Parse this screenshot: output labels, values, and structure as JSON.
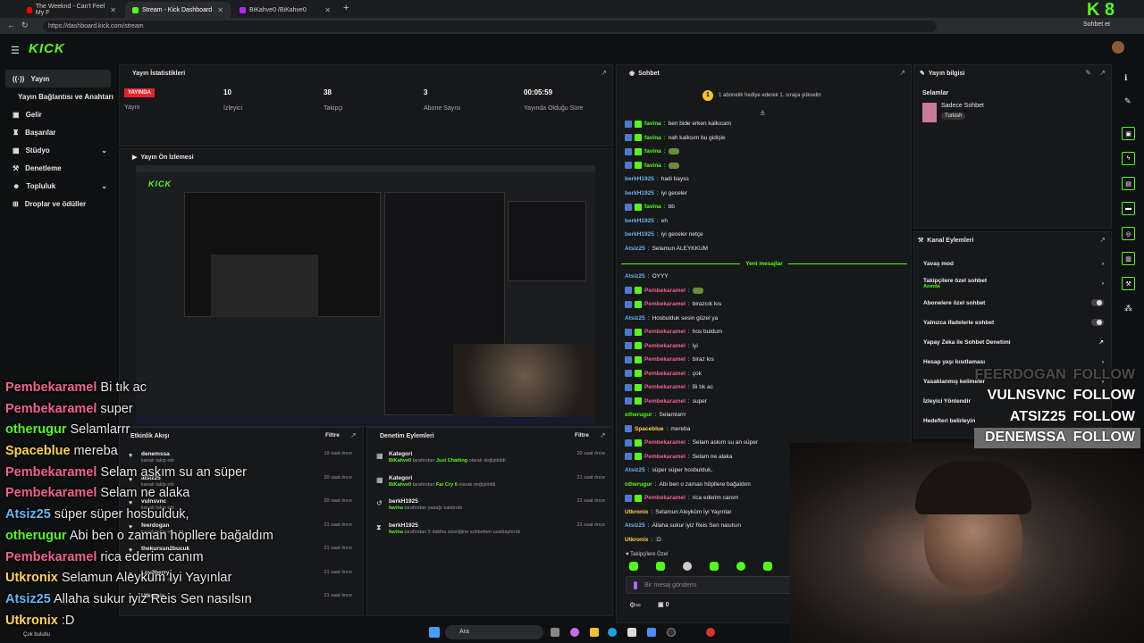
{
  "browser": {
    "tabs": [
      {
        "label": "The Weeknd - Can't Feel My F"
      },
      {
        "label": "Stream - Kick Dashboard"
      },
      {
        "label": "BiKahve0 /BiKahve0"
      }
    ],
    "url": "https://dashboard.kick.com/stream",
    "right_button": "Sohbet et"
  },
  "brand": {
    "logo": "KICK",
    "accent": "#53fc18",
    "corner_logo": "K 8"
  },
  "sidebar": {
    "items": [
      {
        "label": "Yayın",
        "icon": "broadcast-icon"
      },
      {
        "label": "Yayın Bağlantısı ve Anahtarı",
        "icon": ""
      },
      {
        "label": "Gelir",
        "icon": "money-icon"
      },
      {
        "label": "Başarılar",
        "icon": "trophy-icon"
      },
      {
        "label": "Stüdyo",
        "icon": "grid-icon"
      },
      {
        "label": "Denetleme",
        "icon": "wrench-icon"
      },
      {
        "label": "Topluluk",
        "icon": "people-icon"
      },
      {
        "label": "Droplar ve ödüller",
        "icon": "gift-icon"
      }
    ]
  },
  "stats": {
    "title": "Yayın İstatistikleri",
    "live_badge": "YAYINDA",
    "live_label": "Yayın",
    "items": [
      {
        "value": "10",
        "label": "İzleyici"
      },
      {
        "value": "38",
        "label": "Takipçi"
      },
      {
        "value": "3",
        "label": "Abone Sayısı"
      },
      {
        "value": "00:05:59",
        "label": "Yayında Olduğu Süre"
      }
    ]
  },
  "preview": {
    "title": "Yayın Ön İzlemesi"
  },
  "overlay_chat": [
    {
      "name": "Pembekaramel",
      "color": "#f06292",
      "msg": "Bi tık ac"
    },
    {
      "name": "Pembekaramel",
      "color": "#f06292",
      "msg": "super"
    },
    {
      "name": "otherugur",
      "color": "#53fc18",
      "msg": "Selamlarrr"
    },
    {
      "name": "Spaceblue",
      "color": "#ffd54f",
      "msg": "mereba"
    },
    {
      "name": "Pembekaramel",
      "color": "#f06292",
      "msg": "Selam askım su an süper"
    },
    {
      "name": "Pembekaramel",
      "color": "#f06292",
      "msg": "Selam ne alaka"
    },
    {
      "name": "Atsiz25",
      "color": "#64b5f6",
      "msg": "süper süper hosbulduk,"
    },
    {
      "name": "otherugur",
      "color": "#53fc18",
      "msg": "Abi ben o zaman höpllere bağaldım"
    },
    {
      "name": "Pembekaramel",
      "color": "#f06292",
      "msg": "rica ederim canım"
    },
    {
      "name": "Utkronix",
      "color": "#ffd54f",
      "msg": "Selamun Aleyküm İyi Yayınlar"
    },
    {
      "name": "Atsiz25",
      "color": "#64b5f6",
      "msg": "Allaha sukur iyiz Reis Sen nasılsın"
    },
    {
      "name": "Utkronix",
      "color": "#ffd54f",
      "msg": ":D"
    }
  ],
  "overlay_footer": "Çok bulutlu",
  "follow_alerts": [
    {
      "name": "FEERDOGAN",
      "action": "FOLLOW"
    },
    {
      "name": "VULNSVNC",
      "action": "FOLLOW"
    },
    {
      "name": "ATSIZ25",
      "action": "FOLLOW"
    },
    {
      "name": "DENEMSSA",
      "action": "FOLLOW"
    }
  ],
  "activity": {
    "title": "Etkinlik Akışı",
    "filter": "Filtre",
    "items": [
      {
        "name": "denemssa",
        "desc": "kanalı takip etti",
        "time": "19 saat önce"
      },
      {
        "name": "atsiz25",
        "desc": "kanalı takip etti",
        "time": "20 saat önce"
      },
      {
        "name": "vulnsvnc",
        "desc": "kanalı takip etti",
        "time": "20 saat önce"
      },
      {
        "name": "feerdogan",
        "desc": "kanalı takip etti",
        "time": "21 saat önce"
      },
      {
        "name": "thekursun2bucuk",
        "desc": "",
        "time": "21 saat önce"
      },
      {
        "name": "Lov3berry",
        "desc": "kanalı takip etti",
        "time": "21 saat önce"
      },
      {
        "name": "Utkronix",
        "desc": "",
        "time": "21 saat önce"
      }
    ]
  },
  "moderation": {
    "title": "Denetim Eylemleri",
    "filter": "Filtre",
    "items": [
      {
        "title": "Kategori",
        "actor": "BiKahve0",
        "mid": " tarafından ",
        "target": "Just Chatting",
        "end": " olarak değiştirildi",
        "time": "20 saat önce"
      },
      {
        "title": "Kategori",
        "actor": "BiKahve0",
        "mid": " tarafından ",
        "target": "Far Cry 6",
        "end": " olarak değiştirildi",
        "time": "21 saat önce"
      },
      {
        "title": "berkH1925",
        "actor": "favina",
        "mid": " tarafından yasağı kaldırıldı",
        "target": "",
        "end": "",
        "time": "22 saat önce"
      },
      {
        "title": "berkH1925",
        "actor": "favina",
        "mid": " tarafından 5 dakika süreliğine sohbetten uzaklaştırıldı",
        "target": "",
        "end": "",
        "time": "22 saat önce"
      }
    ]
  },
  "chat": {
    "title": "Sohbet",
    "pinned": "1 abonelik hediye ederek 1. sıraya yükselin",
    "new_messages": "Yeni mesajlar",
    "lines": [
      {
        "name": "favina",
        "color": "#53fc18",
        "msg": "ben bide erken kalkıcam",
        "badges": 2,
        "emote": false
      },
      {
        "name": "favina",
        "color": "#53fc18",
        "msg": "nah kalksım bu gidişle",
        "badges": 2,
        "emote": false
      },
      {
        "name": "favina",
        "color": "#53fc18",
        "msg": "",
        "badges": 2,
        "emote": true
      },
      {
        "name": "favina",
        "color": "#53fc18",
        "msg": "",
        "badges": 2,
        "emote": true
      },
      {
        "name": "berkH1925",
        "color": "#64b5f6",
        "msg": "hadi bayss",
        "badges": 0,
        "emote": false
      },
      {
        "name": "berkH1925",
        "color": "#64b5f6",
        "msg": "iyi geceler",
        "badges": 0,
        "emote": false
      },
      {
        "name": "favina",
        "color": "#53fc18",
        "msg": "bb",
        "badges": 2,
        "emote": false
      },
      {
        "name": "berkH1925",
        "color": "#64b5f6",
        "msg": "eh",
        "badges": 0,
        "emote": false
      },
      {
        "name": "berkH1925",
        "color": "#64b5f6",
        "msg": "iyi geceler netçe",
        "badges": 0,
        "emote": false
      },
      {
        "name": "Atsiz25",
        "color": "#64b5f6",
        "msg": "Selamun ALEYKKUM",
        "badges": 0,
        "emote": false
      }
    ],
    "lines_after": [
      {
        "name": "Atsiz25",
        "color": "#64b5f6",
        "msg": "OYYY",
        "badges": 0,
        "emote": false
      },
      {
        "name": "Pembekaramel",
        "color": "#f06292",
        "msg": "",
        "badges": 2,
        "emote": true
      },
      {
        "name": "Pembekaramel",
        "color": "#f06292",
        "msg": "birazcık kıs",
        "badges": 2,
        "emote": false
      },
      {
        "name": "Atsiz25",
        "color": "#64b5f6",
        "msg": "Hosbulduk sesin güzel ya",
        "badges": 0,
        "emote": false
      },
      {
        "name": "Pembekaramel",
        "color": "#f06292",
        "msg": "hos buldum",
        "badges": 2,
        "emote": false
      },
      {
        "name": "Pembekaramel",
        "color": "#f06292",
        "msg": "iyi",
        "badges": 2,
        "emote": false
      },
      {
        "name": "Pembekaramel",
        "color": "#f06292",
        "msg": "biraz kıs",
        "badges": 2,
        "emote": false
      },
      {
        "name": "Pembekaramel",
        "color": "#f06292",
        "msg": "çok",
        "badges": 2,
        "emote": false
      },
      {
        "name": "Pembekaramel",
        "color": "#f06292",
        "msg": "Bi tık ac",
        "badges": 2,
        "emote": false
      },
      {
        "name": "Pembekaramel",
        "color": "#f06292",
        "msg": "super",
        "badges": 2,
        "emote": false
      },
      {
        "name": "otherugur",
        "color": "#53fc18",
        "msg": "Selamlarrr",
        "badges": 0,
        "emote": false
      },
      {
        "name": "Spaceblue",
        "color": "#ffd54f",
        "msg": "mereba",
        "badges": 1,
        "emote": false
      },
      {
        "name": "Pembekaramel",
        "color": "#f06292",
        "msg": "Selam askım su an süper",
        "badges": 2,
        "emote": false
      },
      {
        "name": "Pembekaramel",
        "color": "#f06292",
        "msg": "Selam ne alaka",
        "badges": 2,
        "emote": false
      },
      {
        "name": "Atsiz25",
        "color": "#64b5f6",
        "msg": "süper süper hosbulduk,",
        "badges": 0,
        "emote": false
      },
      {
        "name": "otherugur",
        "color": "#53fc18",
        "msg": "Abi ben o zaman höpllere bağaldım",
        "badges": 0,
        "emote": false
      },
      {
        "name": "Pembekaramel",
        "color": "#f06292",
        "msg": "rica ederim canım",
        "badges": 2,
        "emote": false
      },
      {
        "name": "Utkronix",
        "color": "#ffd54f",
        "msg": "Selamun Aleyküm İyi Yayınlar",
        "badges": 0,
        "emote": false
      },
      {
        "name": "Atsiz25",
        "color": "#64b5f6",
        "msg": "Allaha sukur iyiz Reis Sen nasılsın",
        "badges": 0,
        "emote": false
      },
      {
        "name": "Utkronix",
        "color": "#ffd54f",
        "msg": ":D",
        "badges": 0,
        "emote": false
      }
    ],
    "follower_label": "Takipçilere Özel",
    "input_placeholder": "Bir mesaj gönderin",
    "points": "0"
  },
  "stream_info": {
    "title": "Yayın bilgisi",
    "stream_title": "Selamlar",
    "category": "Sadece Sohbet",
    "tag": "Turkish"
  },
  "channel_actions": {
    "title": "Kanal Eylemleri",
    "items": [
      {
        "label": "Yavaş mod",
        "sub": "",
        "control": "arrow"
      },
      {
        "label": "Takipçilere özel sohbet",
        "sub": "Anında",
        "control": "arrow"
      },
      {
        "label": "Abonelere özel sohbet",
        "sub": "",
        "control": "toggle"
      },
      {
        "label": "Yalnızca ifadelerle sohbet",
        "sub": "",
        "control": "toggle"
      },
      {
        "label": "Yapay Zeka ile Sohbet Denetimi",
        "sub": "",
        "control": "link"
      },
      {
        "label": "Hesap yaşı kısıtlaması",
        "sub": "",
        "control": "arrow"
      },
      {
        "label": "Yasaklanmış kelimeler",
        "sub": "",
        "control": "arrow"
      },
      {
        "label": "İzleyici Yönlendir",
        "sub": "",
        "control": "none"
      },
      {
        "label": "Hedefleri belirleyin",
        "sub": "",
        "control": "none"
      }
    ]
  },
  "taskbar": {
    "search": "Ara"
  }
}
